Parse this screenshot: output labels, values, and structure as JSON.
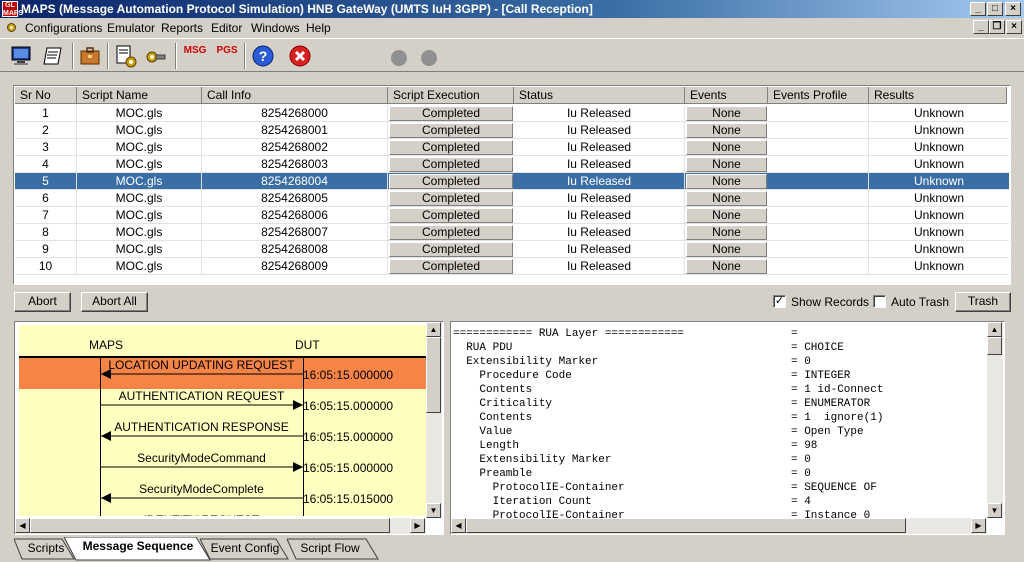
{
  "window": {
    "logo_text": "GL MAPS",
    "title": "MAPS (Message Automation Protocol Simulation) HNB GateWay (UMTS IuH 3GPP) - [Call Reception]",
    "controls": [
      "_",
      "□",
      "×"
    ],
    "mdi_controls": [
      "_",
      "❐",
      "×"
    ]
  },
  "menu": [
    "Configurations",
    "Emulator",
    "Reports",
    "Editor",
    "Windows",
    "Help"
  ],
  "toolbar": {
    "icons": [
      "monitor-icon",
      "notes-icon",
      "briefcase-icon",
      "script-edit-icon",
      "gear-key-icon",
      "msg-icon",
      "pgs-icon",
      "help-icon",
      "stop-icon",
      "record-dot-icon",
      "play-dot-icon"
    ],
    "msg_label": "MSG",
    "pgs_label": "PGS",
    "help_label": "?",
    "stop_label": "✕"
  },
  "table": {
    "columns": [
      "Sr No",
      "Script Name",
      "Call Info",
      "Script Execution",
      "Status",
      "Events",
      "Events Profile",
      "Results"
    ],
    "selected_index": 4,
    "rows": [
      {
        "sr": "1",
        "script": "MOC.gls",
        "call": "8254268000",
        "exec": "Completed",
        "status": "Iu Released",
        "events": "None",
        "profile": "",
        "result": "Unknown"
      },
      {
        "sr": "2",
        "script": "MOC.gls",
        "call": "8254268001",
        "exec": "Completed",
        "status": "Iu Released",
        "events": "None",
        "profile": "",
        "result": "Unknown"
      },
      {
        "sr": "3",
        "script": "MOC.gls",
        "call": "8254268002",
        "exec": "Completed",
        "status": "Iu Released",
        "events": "None",
        "profile": "",
        "result": "Unknown"
      },
      {
        "sr": "4",
        "script": "MOC.gls",
        "call": "8254268003",
        "exec": "Completed",
        "status": "Iu Released",
        "events": "None",
        "profile": "",
        "result": "Unknown"
      },
      {
        "sr": "5",
        "script": "MOC.gls",
        "call": "8254268004",
        "exec": "Completed",
        "status": "Iu Released",
        "events": "None",
        "profile": "",
        "result": "Unknown"
      },
      {
        "sr": "6",
        "script": "MOC.gls",
        "call": "8254268005",
        "exec": "Completed",
        "status": "Iu Released",
        "events": "None",
        "profile": "",
        "result": "Unknown"
      },
      {
        "sr": "7",
        "script": "MOC.gls",
        "call": "8254268006",
        "exec": "Completed",
        "status": "Iu Released",
        "events": "None",
        "profile": "",
        "result": "Unknown"
      },
      {
        "sr": "8",
        "script": "MOC.gls",
        "call": "8254268007",
        "exec": "Completed",
        "status": "Iu Released",
        "events": "None",
        "profile": "",
        "result": "Unknown"
      },
      {
        "sr": "9",
        "script": "MOC.gls",
        "call": "8254268008",
        "exec": "Completed",
        "status": "Iu Released",
        "events": "None",
        "profile": "",
        "result": "Unknown"
      },
      {
        "sr": "10",
        "script": "MOC.gls",
        "call": "8254268009",
        "exec": "Completed",
        "status": "Iu Released",
        "events": "None",
        "profile": "",
        "result": "Unknown"
      }
    ]
  },
  "actions": {
    "abort": "Abort",
    "abort_all": "Abort All",
    "show_records": "Show Records",
    "show_records_checked": true,
    "auto_trash": "Auto Trash",
    "auto_trash_checked": false,
    "trash": "Trash"
  },
  "sequence": {
    "left_entity": "MAPS",
    "right_entity": "DUT",
    "highlight_color": "#f58446",
    "background_color": "#ffffc0",
    "messages": [
      {
        "label": "LOCATION UPDATING REQUEST",
        "direction": "left",
        "time": "16:05:15.000000",
        "highlight": true
      },
      {
        "label": "AUTHENTICATION REQUEST",
        "direction": "right",
        "time": "16:05:15.000000",
        "highlight": false
      },
      {
        "label": "AUTHENTICATION RESPONSE",
        "direction": "left",
        "time": "16:05:15.000000",
        "highlight": false
      },
      {
        "label": "SecurityModeCommand",
        "direction": "right",
        "time": "16:05:15.000000",
        "highlight": false
      },
      {
        "label": "SecurityModeComplete",
        "direction": "left",
        "time": "16:05:15.015000",
        "highlight": false
      },
      {
        "label": "IDENTITY REQUEST",
        "direction": "right",
        "time": "",
        "highlight": false
      }
    ]
  },
  "decode": {
    "lines": [
      {
        "name": "============ RUA Layer ============",
        "value": "="
      },
      {
        "name": "  RUA PDU",
        "value": "= CHOICE"
      },
      {
        "name": "  Extensibility Marker",
        "value": "= 0"
      },
      {
        "name": "    Procedure Code",
        "value": "= INTEGER"
      },
      {
        "name": "    Contents",
        "value": "= 1 id-Connect"
      },
      {
        "name": "    Criticality",
        "value": "= ENUMERATOR"
      },
      {
        "name": "    Contents",
        "value": "= 1  ignore(1)"
      },
      {
        "name": "    Value",
        "value": "= Open Type"
      },
      {
        "name": "    Length",
        "value": "= 98"
      },
      {
        "name": "    Extensibility Marker",
        "value": "= 0"
      },
      {
        "name": "    Preamble",
        "value": "= 0"
      },
      {
        "name": "      ProtocolIE-Container",
        "value": "= SEQUENCE OF"
      },
      {
        "name": "      Iteration Count",
        "value": "= 4"
      },
      {
        "name": "      ProtocolIE-Container",
        "value": "= Instance 0"
      }
    ]
  },
  "tabs": [
    "Scripts",
    "Message Sequence",
    "Event Config",
    "Script Flow"
  ],
  "active_tab": 1
}
